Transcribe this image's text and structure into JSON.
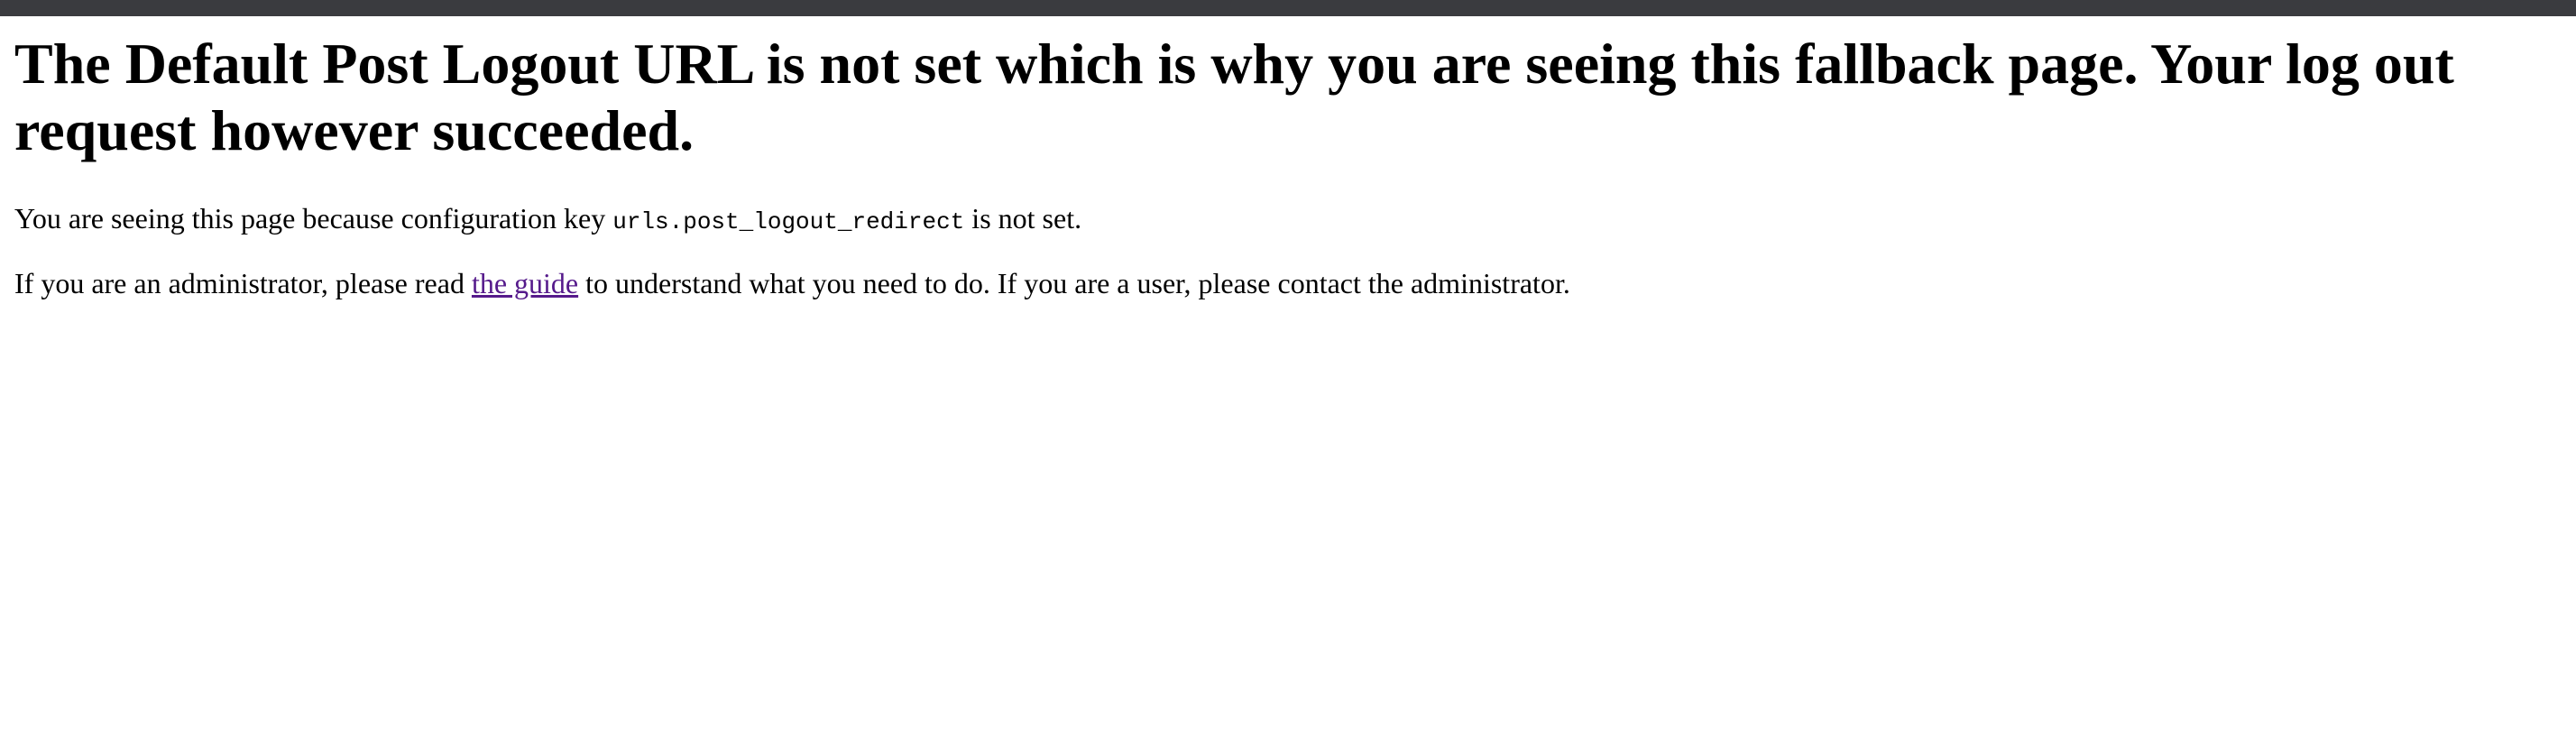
{
  "heading": "The Default Post Logout URL is not set which is why you are seeing this fallback page. Your log out request however succeeded.",
  "paragraph1": {
    "before": "You are seeing this page because configuration key ",
    "code": "urls.post_logout_redirect",
    "after": " is not set."
  },
  "paragraph2": {
    "before": "If you are an administrator, please read ",
    "link": "the guide",
    "after": " to understand what you need to do. If you are a user, please contact the administrator."
  },
  "colors": {
    "top_bar": "#3a3b3f",
    "link": "#551a8b",
    "text": "#000000",
    "background": "#ffffff"
  }
}
